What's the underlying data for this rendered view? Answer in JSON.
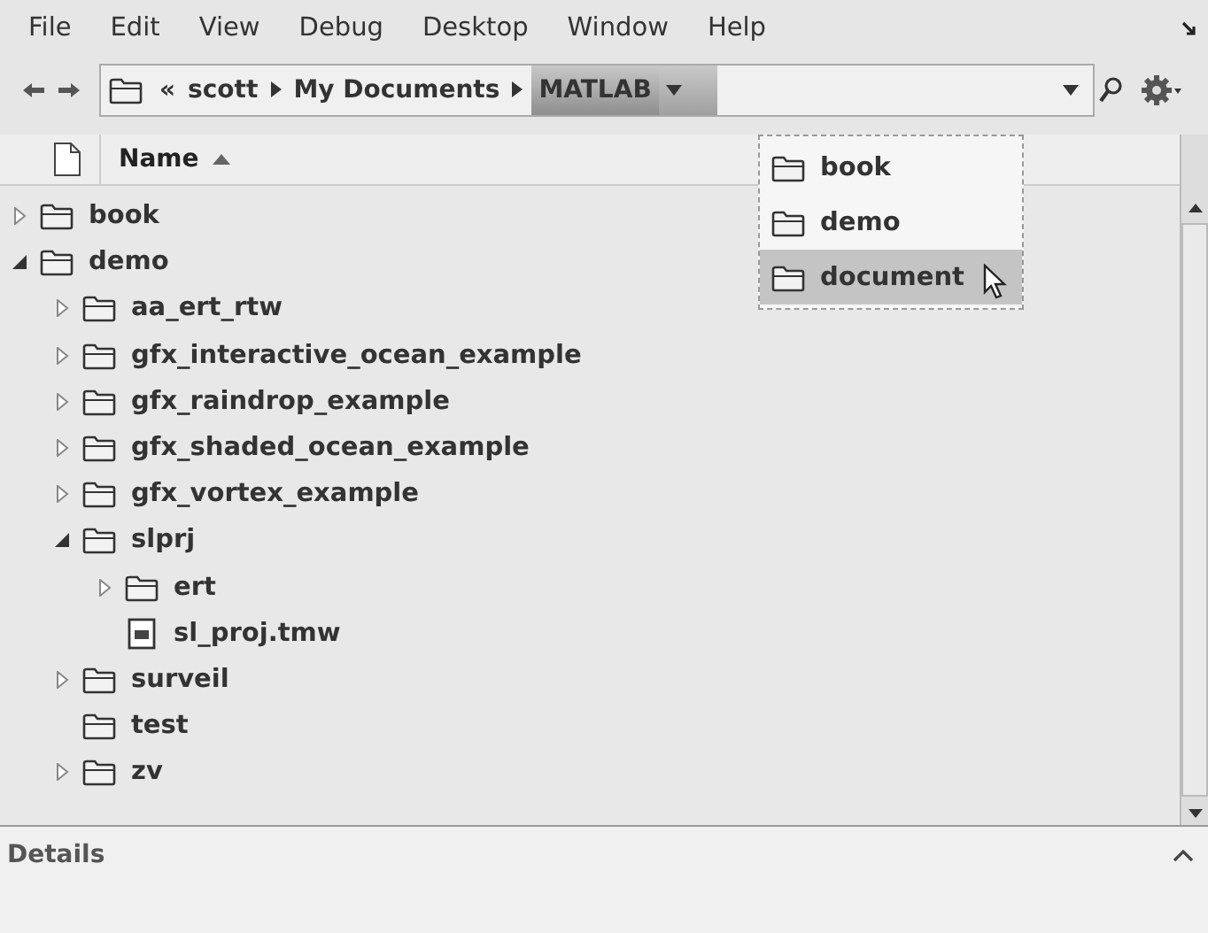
{
  "menu": [
    {
      "label": "File"
    },
    {
      "label": "Edit"
    },
    {
      "label": "View"
    },
    {
      "label": "Debug"
    },
    {
      "label": "Desktop"
    },
    {
      "label": "Window"
    },
    {
      "label": "Help"
    }
  ],
  "address": {
    "overflow": "«",
    "crumbs": [
      {
        "label": "scott",
        "selected": false
      },
      {
        "label": "My Documents",
        "selected": false
      },
      {
        "label": "MATLAB",
        "selected": true
      }
    ]
  },
  "dropdown": [
    {
      "label": "book",
      "selected": false
    },
    {
      "label": "demo",
      "selected": false
    },
    {
      "label": "document",
      "selected": true
    }
  ],
  "column_header": {
    "label": "Name",
    "sorted_ascending": true
  },
  "tree": [
    {
      "label": "book",
      "kind": "folder",
      "expandable": true,
      "expanded": false
    },
    {
      "label": "demo",
      "kind": "folder",
      "expandable": true,
      "expanded": true,
      "children": [
        {
          "label": "aa_ert_rtw",
          "kind": "folder",
          "expandable": true,
          "expanded": false
        },
        {
          "label": "gfx_interactive_ocean_example",
          "kind": "folder",
          "expandable": true,
          "expanded": false
        },
        {
          "label": "gfx_raindrop_example",
          "kind": "folder",
          "expandable": true,
          "expanded": false
        },
        {
          "label": "gfx_shaded_ocean_example",
          "kind": "folder",
          "expandable": true,
          "expanded": false
        },
        {
          "label": "gfx_vortex_example",
          "kind": "folder",
          "expandable": true,
          "expanded": false
        },
        {
          "label": "slprj",
          "kind": "folder",
          "expandable": true,
          "expanded": true,
          "children": [
            {
              "label": "ert",
              "kind": "folder",
              "expandable": true,
              "expanded": false
            },
            {
              "label": "sl_proj.tmw",
              "kind": "file",
              "expandable": false
            }
          ]
        },
        {
          "label": "surveil",
          "kind": "folder",
          "expandable": true,
          "expanded": false
        },
        {
          "label": "test",
          "kind": "folder",
          "expandable": false
        },
        {
          "label": "zv",
          "kind": "folder",
          "expandable": true,
          "expanded": false
        }
      ]
    }
  ],
  "details": {
    "title": "Details",
    "expanded": false
  }
}
